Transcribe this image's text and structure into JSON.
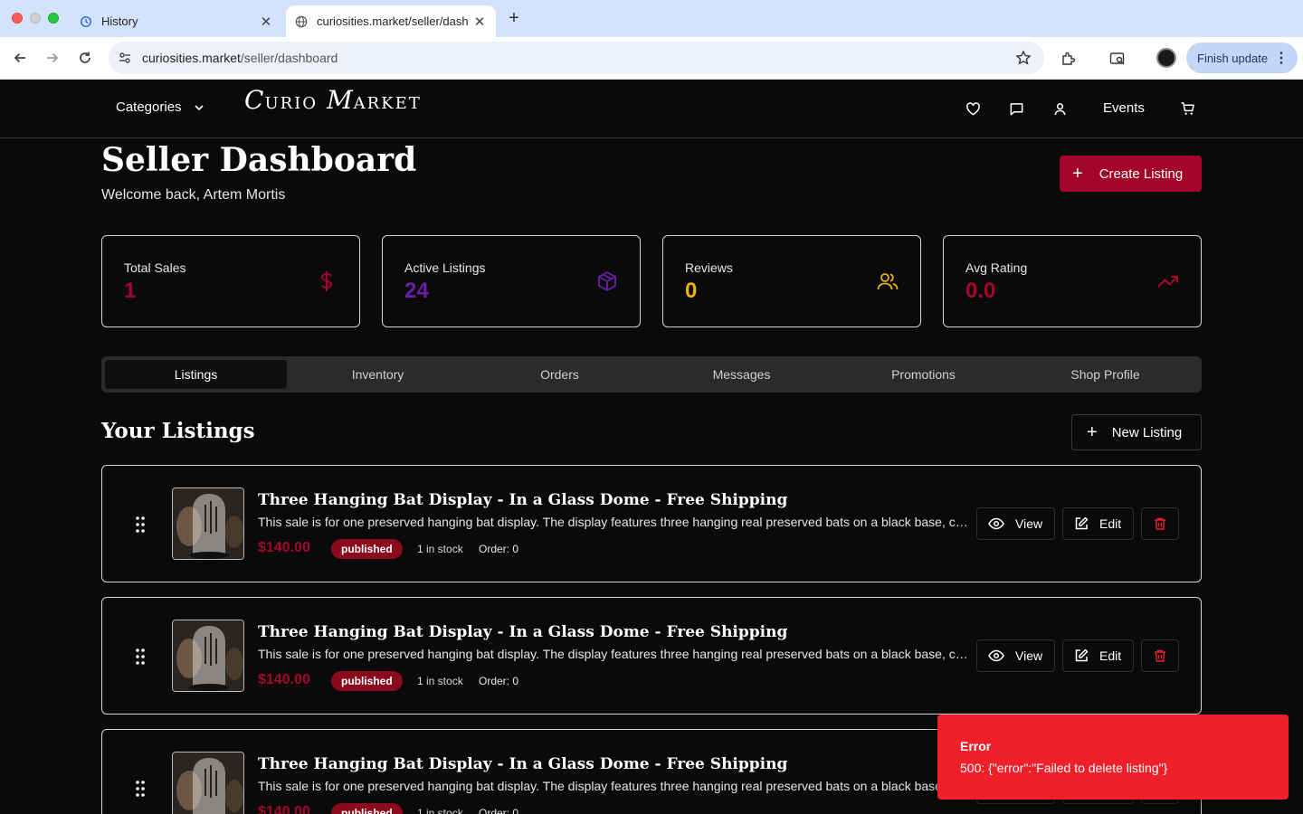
{
  "browser": {
    "tabs": [
      {
        "label": "History",
        "icon": "history-icon",
        "active": false
      },
      {
        "label": "curiosities.market/seller/dash",
        "icon": "globe-icon",
        "active": true
      }
    ],
    "url_host": "curiosities.market",
    "url_path": "/seller/dashboard",
    "finish_update_label": "Finish update"
  },
  "header": {
    "categories_label": "Categories",
    "logo_part1_initial": "C",
    "logo_part1_rest": "URIO",
    "logo_part2_initial": "M",
    "logo_part2_rest": "ARKET",
    "events_label": "Events"
  },
  "dashboard": {
    "title": "Seller Dashboard",
    "welcome": "Welcome back, Artem Mortis",
    "create_listing_label": "Create Listing",
    "stats": [
      {
        "label": "Total Sales",
        "value": "1",
        "color": "#a4062a",
        "icon": "dollar-icon"
      },
      {
        "label": "Active Listings",
        "value": "24",
        "color": "#6b1fa8",
        "icon": "package-icon"
      },
      {
        "label": "Reviews",
        "value": "0",
        "color": "#eab308",
        "icon": "users-icon"
      },
      {
        "label": "Avg Rating",
        "value": "0.0",
        "color": "#a4062a",
        "icon": "trending-up-icon"
      }
    ],
    "tabs": [
      "Listings",
      "Inventory",
      "Orders",
      "Messages",
      "Promotions",
      "Shop Profile"
    ],
    "active_tab": "Listings",
    "listings_title": "Your Listings",
    "new_listing_label": "New Listing",
    "listings": [
      {
        "title": "Three Hanging Bat Display - In a Glass Dome - Free Shipping",
        "description": "This sale is for one preserved hanging bat display. The display features  three hanging real preserved bats on a black base, covered in a glass dome.",
        "price": "$140.00",
        "status": "published",
        "stock": "1 in stock",
        "order": "Order: 0"
      },
      {
        "title": "Three Hanging Bat Display - In a Glass Dome - Free Shipping",
        "description": "This sale is for one preserved hanging bat display. The display features  three hanging real preserved bats on a black base, covered in a glass dome.",
        "price": "$140.00",
        "status": "published",
        "stock": "1 in stock",
        "order": "Order: 0"
      },
      {
        "title": "Three Hanging Bat Display - In a Glass Dome - Free Shipping",
        "description": "This sale is for one preserved hanging bat display. The display features  three hanging real preserved bats on a black base, covered in a glass dome.",
        "price": "$140.00",
        "status": "published",
        "stock": "1 in stock",
        "order": "Order: 0"
      }
    ],
    "view_label": "View",
    "edit_label": "Edit"
  },
  "toast": {
    "title": "Error",
    "message": "500: {\"error\":\"Failed to delete listing\"}"
  }
}
